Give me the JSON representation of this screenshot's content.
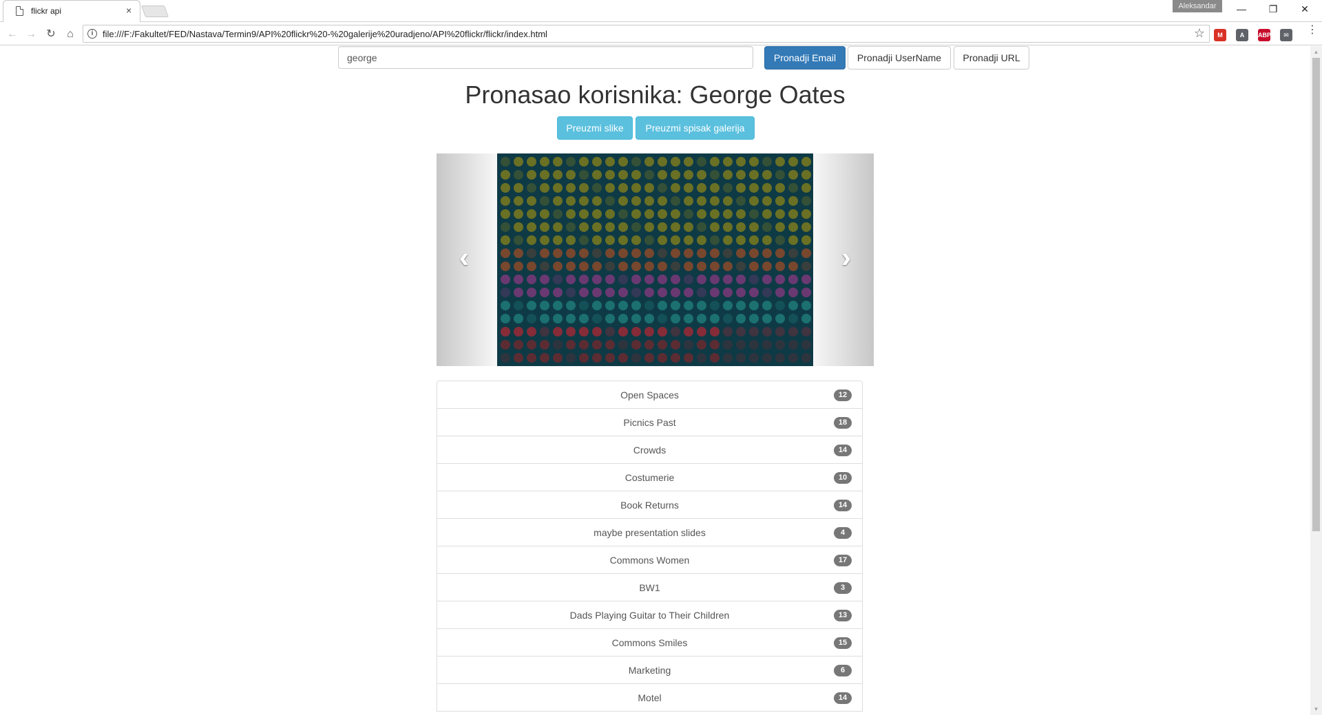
{
  "browser": {
    "tab_title": "flickr api",
    "tab_close": "×",
    "user": "Aleksandar",
    "url": "file:///F:/Fakultet/FED/Nastava/Termin9/API%20flickr%20-%20galerije%20uradjeno/API%20flickr/flickr/index.html",
    "info_glyph": "i",
    "star_glyph": "☆",
    "back_glyph": "←",
    "forward_glyph": "→",
    "reload_glyph": "↻",
    "home_glyph": "⌂",
    "minimize_glyph": "—",
    "restore_glyph": "❐",
    "close_glyph": "✕",
    "menu_glyph": "⋮",
    "extensions": [
      {
        "name": "gmail-icon",
        "label": "M",
        "color": "#d93025"
      },
      {
        "name": "shield-extension-icon",
        "label": "A",
        "color": "#5f6368"
      },
      {
        "name": "adblock-plus-icon",
        "label": "ABP",
        "color": "#c70d2c"
      },
      {
        "name": "mail-extension-icon",
        "label": "✉",
        "color": "#5f6368"
      }
    ],
    "scroll_up": "▲",
    "scroll_down": "▼"
  },
  "search": {
    "value": "george",
    "buttons": {
      "email": "Pronadji Email",
      "username": "Pronadji UserName",
      "url": "Pronadji URL"
    }
  },
  "heading": "Pronasao korisnika: George Oates",
  "actions": {
    "photos": "Preuzmi slike",
    "galleries": "Preuzmi spisak galerija"
  },
  "carousel": {
    "prev_glyph": "‹",
    "next_glyph": "›",
    "image_colors": [
      "#7a7a1e",
      "#a08a18",
      "#8a4a2a",
      "#7a3a7a",
      "#1f7a78",
      "#9a2a36",
      "#6a2a30"
    ]
  },
  "galleries": [
    {
      "name": "Open Spaces",
      "count": "12"
    },
    {
      "name": "Picnics Past",
      "count": "18"
    },
    {
      "name": "Crowds",
      "count": "14"
    },
    {
      "name": "Costumerie",
      "count": "10"
    },
    {
      "name": "Book Returns",
      "count": "14"
    },
    {
      "name": "maybe presentation slides",
      "count": "4"
    },
    {
      "name": "Commons Women",
      "count": "17"
    },
    {
      "name": "BW1",
      "count": "3"
    },
    {
      "name": "Dads Playing Guitar to Their Children",
      "count": "13"
    },
    {
      "name": "Commons Smiles",
      "count": "15"
    },
    {
      "name": "Marketing",
      "count": "6"
    },
    {
      "name": "Motel",
      "count": "14"
    }
  ]
}
